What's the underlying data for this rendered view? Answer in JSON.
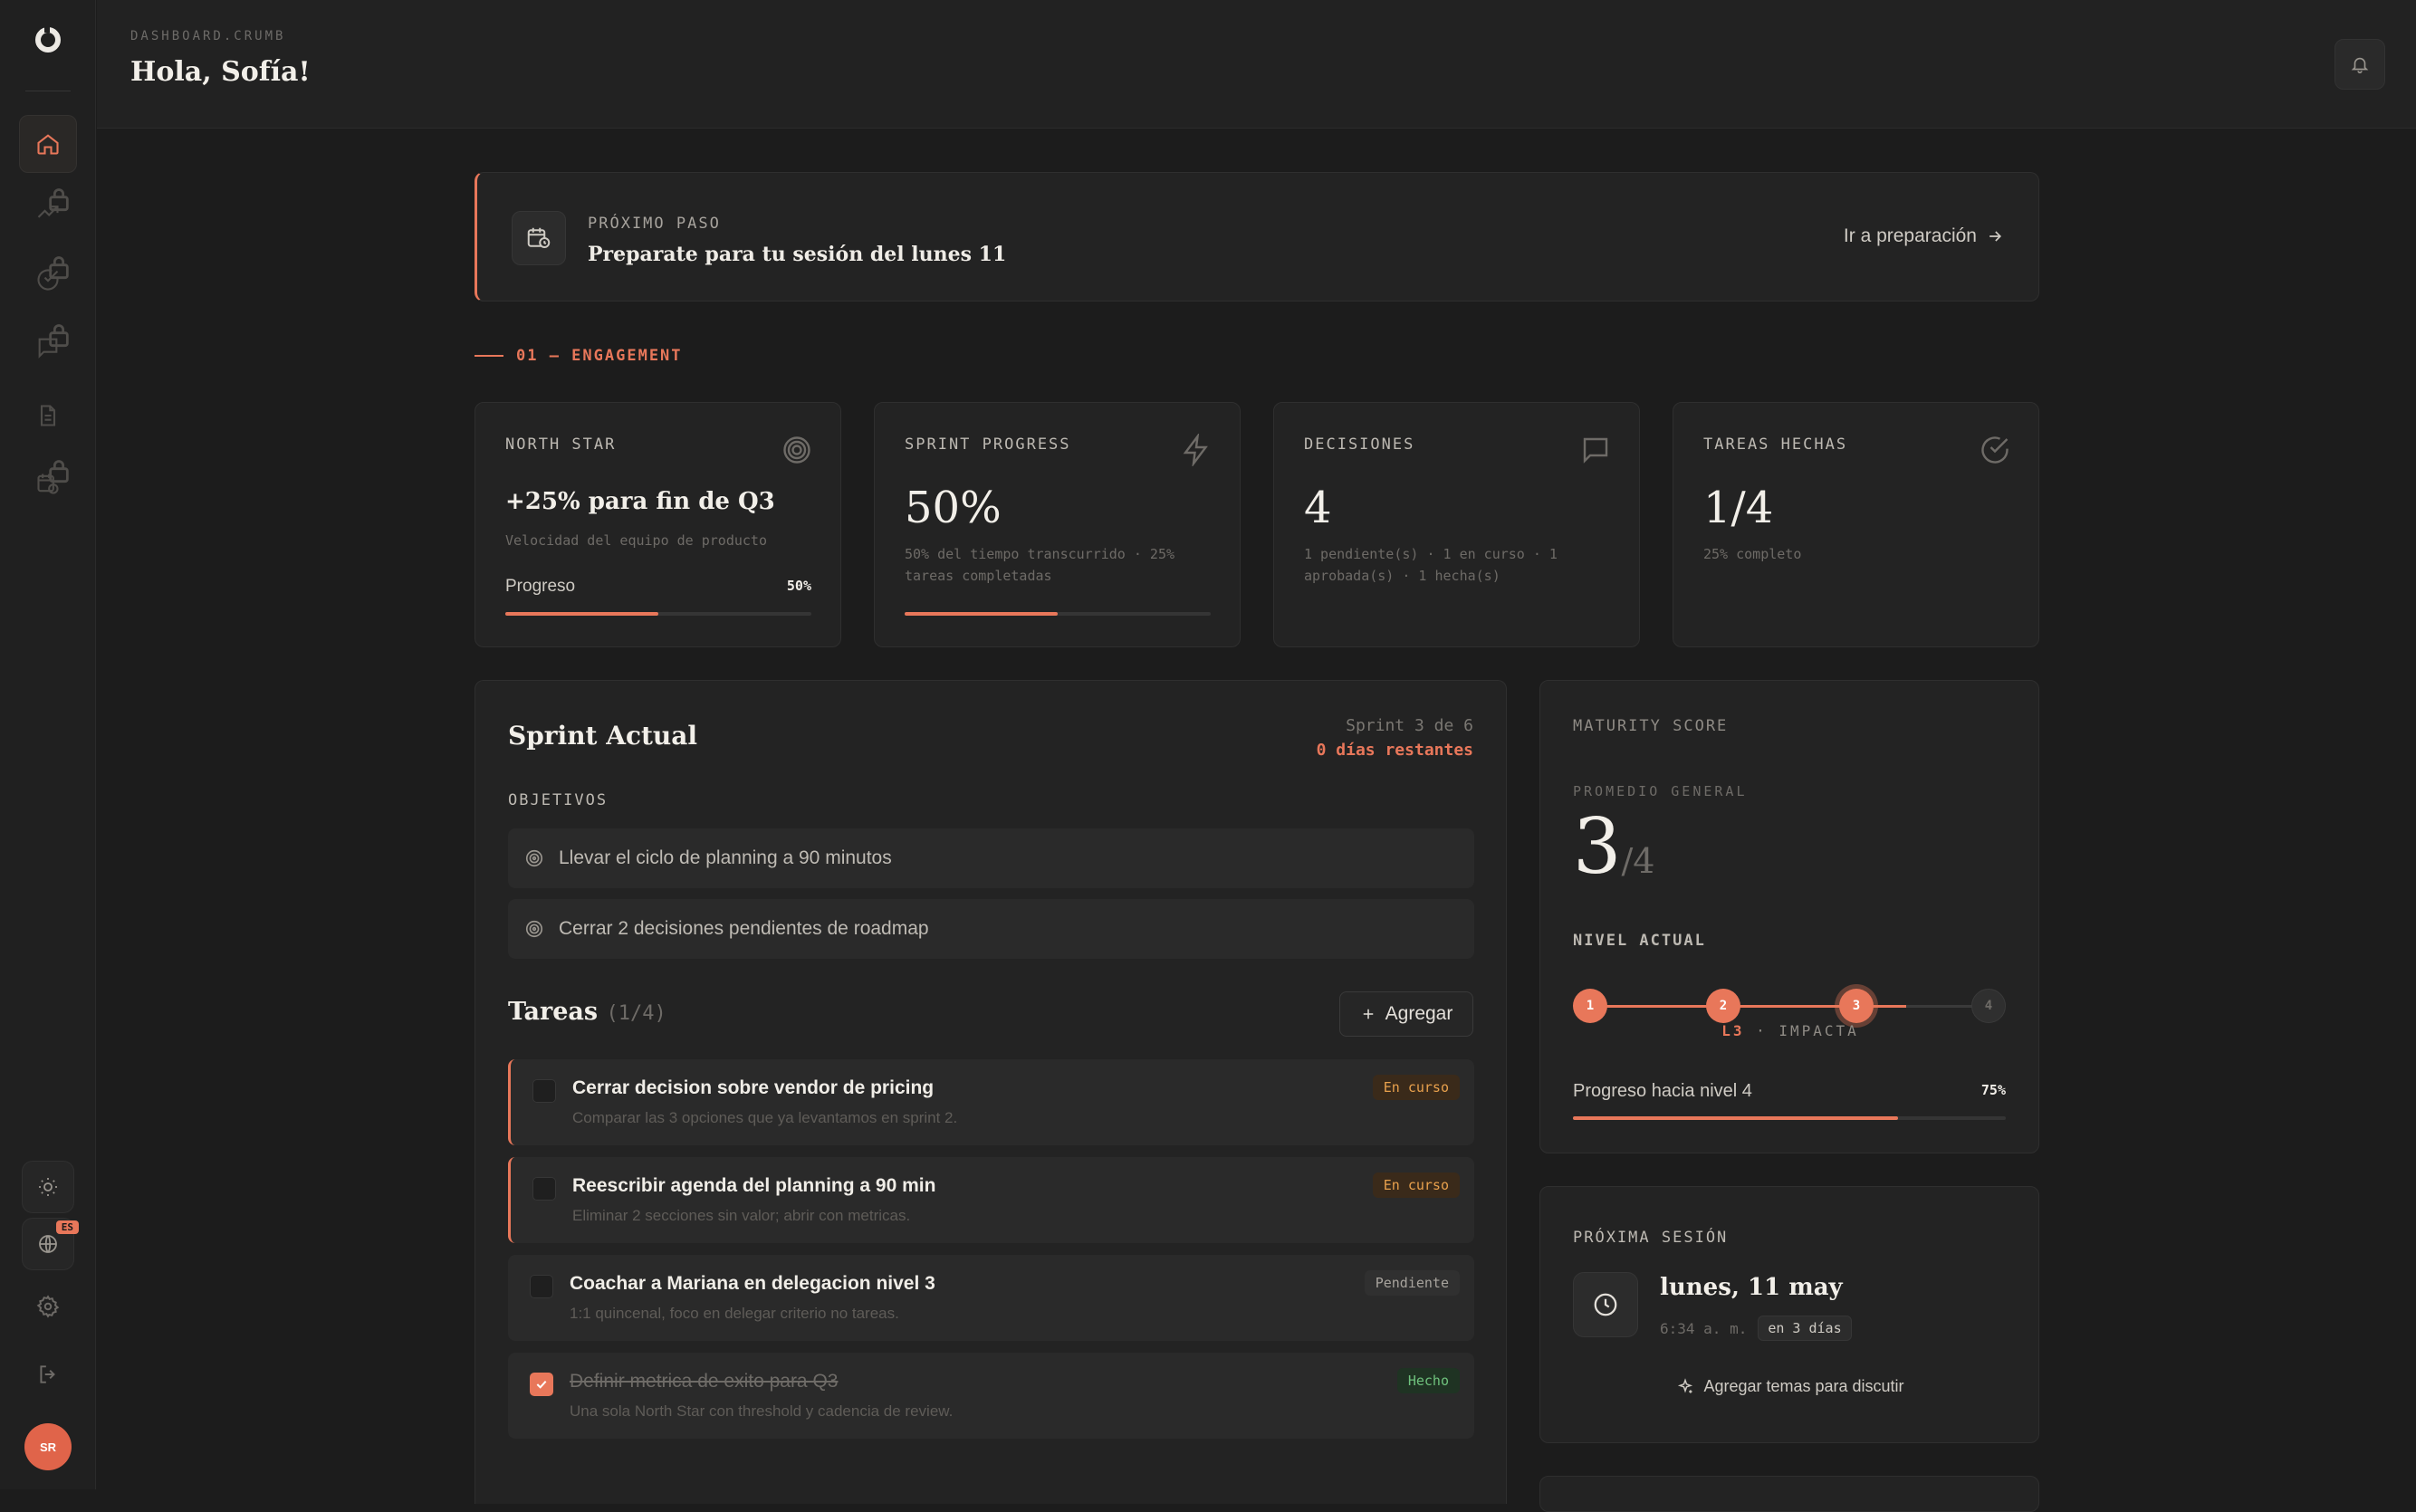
{
  "colors": {
    "accent": "#e8775a",
    "background": "#1c1c1c",
    "card": "#232323"
  },
  "sidebar": {
    "nav": [
      {
        "name": "home",
        "icon": "home-icon",
        "active": true,
        "locked": false
      },
      {
        "name": "trends",
        "icon": "trending-up-icon",
        "active": false,
        "locked": true
      },
      {
        "name": "checks",
        "icon": "check-circle-icon",
        "active": false,
        "locked": true
      },
      {
        "name": "messages",
        "icon": "message-icon",
        "active": false,
        "locked": true
      },
      {
        "name": "documents",
        "icon": "document-icon",
        "active": false,
        "locked": false
      },
      {
        "name": "calendar",
        "icon": "calendar-clock-icon",
        "active": false,
        "locked": true
      }
    ],
    "lang_badge": "ES",
    "avatar_initials": "SR"
  },
  "header": {
    "crumb": "DASHBOARD.CRUMB",
    "greeting": "Hola, Sofía!"
  },
  "next_step": {
    "label": "PRÓXIMO PASO",
    "text": "Preparate para tu sesión del lunes 11",
    "link": "Ir a preparación"
  },
  "section_label": "01 — ENGAGEMENT",
  "metrics": [
    {
      "title": "NORTH STAR",
      "icon": "target-icon",
      "value": "+25% para fin de Q3",
      "sub": "Velocidad del equipo de producto",
      "progress_label": "Progreso",
      "progress_value": "50%",
      "progress": 0.5
    },
    {
      "title": "SPRINT PROGRESS",
      "icon": "lightning-icon",
      "value": "50%",
      "sub": "50% del tiempo transcurrido · 25% tareas completadas",
      "progress": 0.5
    },
    {
      "title": "DECISIONES",
      "icon": "message-icon",
      "value": "4",
      "sub": "1 pendiente(s) · 1 en curso · 1 aprobada(s) · 1 hecha(s)"
    },
    {
      "title": "TAREAS HECHAS",
      "icon": "check-circle-icon",
      "value": "1/4",
      "sub": "25% completo"
    }
  ],
  "sprint": {
    "title": "Sprint Actual",
    "meta": "Sprint 3 de 6",
    "remaining": "0 días restantes",
    "objectives_label": "OBJETIVOS",
    "objectives": [
      "Llevar el ciclo de planning a 90 minutos",
      "Cerrar 2 decisiones pendientes de roadmap"
    ],
    "tasks_title": "Tareas",
    "tasks_count": "(1/4)",
    "add_label": "Agregar",
    "tasks": [
      {
        "title": "Cerrar decision sobre vendor de pricing",
        "desc": "Comparar las 3 opciones que ya levantamos en sprint 2.",
        "status": "En curso"
      },
      {
        "title": "Reescribir agenda del planning a 90 min",
        "desc": "Eliminar 2 secciones sin valor; abrir con metricas.",
        "status": "En curso"
      },
      {
        "title": "Coachar a Mariana en delegacion nivel 3",
        "desc": "1:1 quincenal, foco en delegar criterio no tareas.",
        "status": "Pendiente"
      },
      {
        "title": "Definir metrica de exito para Q3",
        "desc": "Una sola North Star con threshold y cadencia de review.",
        "status": "Hecho"
      }
    ]
  },
  "maturity": {
    "title": "MATURITY SCORE",
    "avg_label": "PROMEDIO GENERAL",
    "score": "3",
    "score_max": "/4",
    "level_label": "NIVEL ACTUAL",
    "levels": [
      "1",
      "2",
      "3",
      "4"
    ],
    "current_level": 3,
    "level_code": "L3",
    "level_name": " · IMPACTA",
    "progress_label": "Progreso hacia nivel 4",
    "progress_value": "75%",
    "progress": 0.75
  },
  "session": {
    "title": "PRÓXIMA SESIÓN",
    "date": "lunes, 11 may",
    "time": "6:34 a. m.",
    "in": "en 3 días",
    "add_label": "Agregar temas para discutir"
  }
}
